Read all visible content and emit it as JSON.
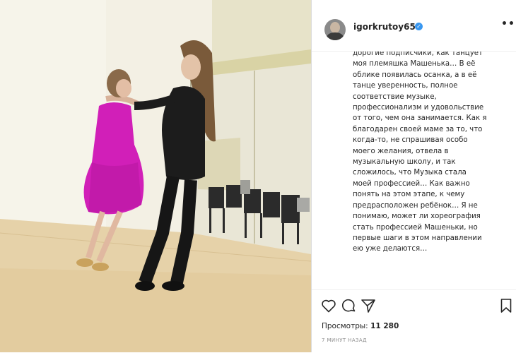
{
  "post": {
    "username": "igorkrutoy65",
    "verified_mark": "✓",
    "more_label": "•••",
    "caption_lines": [
      "дорогие подписчики, как танцует",
      "моя племяшка Машенька… В её",
      "облике появилась осанка, а в её",
      "танце уверенность, полное",
      "соответствие музыке,",
      "профессионализм и удовольствие",
      "от того, чем она занимается. Как я",
      "благодарен своей маме за то, что",
      "когда-то, не спрашивая особо",
      "моего желания, отвела в",
      "музыкальную школу, и так",
      "сложилось, что Музыка стала",
      "моей профессией… Как важно",
      "понять на этом этапе, к чему",
      "предрасположен ребёнок… Я не",
      "понимаю, может ли хореография",
      "стать профессией Машеньки, но",
      "первые шаги в этом направлении",
      "ею уже делаются…"
    ],
    "views_label": "Просмотры:",
    "views_count": "11 280",
    "timestamp": "7 МИНУТ НАЗАД"
  },
  "icons": {
    "avatar": "avatar",
    "verified": "verified-badge-icon",
    "more": "more-options-icon",
    "like": "heart-icon",
    "comment": "comment-icon",
    "share": "share-icon",
    "save": "bookmark-icon"
  },
  "colors": {
    "verified": "#3897f0",
    "text": "#262626",
    "muted": "#8e8e8e",
    "dress": "#d11fb8"
  }
}
